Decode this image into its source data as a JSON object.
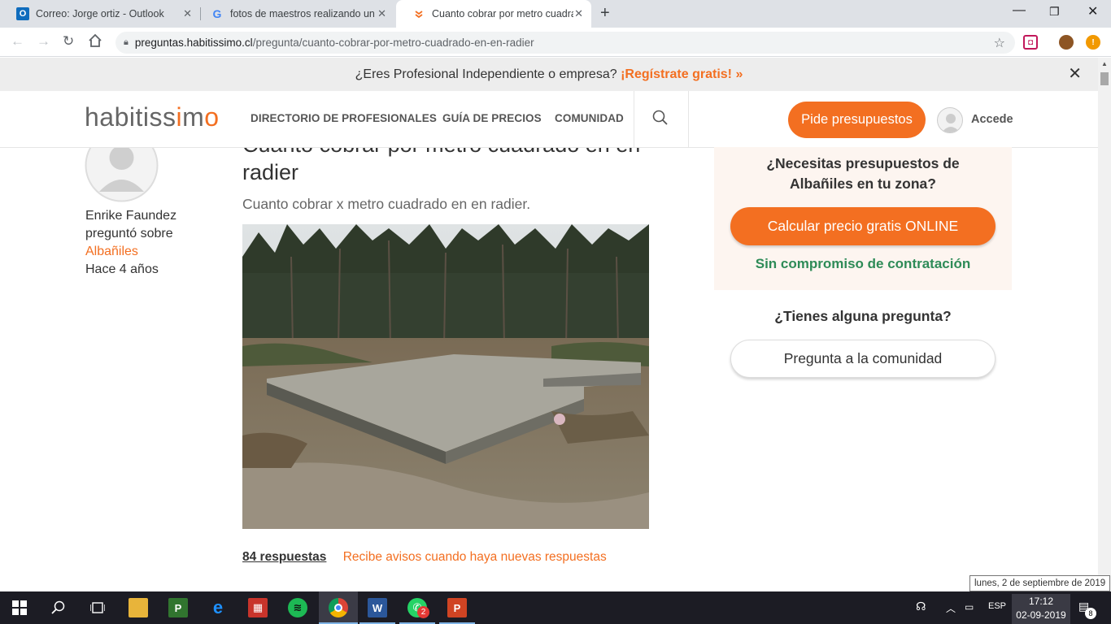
{
  "browser": {
    "tabs": [
      {
        "title": "Correo: Jorge ortiz - Outlook",
        "favicon": "outlook-icon"
      },
      {
        "title": "fotos de maestros realizando un",
        "favicon": "google-icon"
      },
      {
        "title": "Cuanto cobrar por metro cuadrado",
        "favicon": "habitissimo-icon"
      }
    ],
    "url_host": "preguntas.habitissimo.cl",
    "url_path": "/pregunta/cuanto-cobrar-por-metro-cuadrado-en-en-radier"
  },
  "promo": {
    "text": "¿Eres Profesional Independiente o empresa?",
    "cta": "¡Regístrate gratis! »"
  },
  "header": {
    "logo_a": "habitiss",
    "logo_b": "i",
    "logo_c": "m",
    "logo_d": "o",
    "nav": [
      "DIRECTORIO DE PROFESIONALES",
      "GUÍA DE PRECIOS",
      "COMUNIDAD"
    ],
    "cta_button": "Pide presupuestos",
    "login": "Accede"
  },
  "question": {
    "title_line1": "Cuanto cobrar por metro cuadrado en en",
    "title_line2": "radier",
    "description": "Cuanto cobrar x metro cuadrado en en radier.",
    "answers_count": "84 respuestas",
    "notify_link": "Recibe avisos cuando haya nuevas respuestas"
  },
  "author": {
    "name": "Enrike Faundez",
    "verb": "preguntó sobre",
    "category": "Albañiles",
    "time": "Hace 4 años"
  },
  "sidebar": {
    "promo_heading_1": "¿Necesitas presupuestos de",
    "promo_heading_2": "Albañiles en tu zona?",
    "calc_button": "Calcular precio gratis ONLINE",
    "no_commitment": "Sin compromiso de contratación",
    "question_heading": "¿Tienes alguna pregunta?",
    "community_button": "Pregunta a la comunidad"
  },
  "taskbar": {
    "language": "ESP",
    "time": "17:12",
    "date": "02-09-2019",
    "tooltip": "lunes, 2 de septiembre de 2019",
    "whatsapp_badge": "2",
    "notifications": "8"
  },
  "colors": {
    "brand_orange": "#f36f21",
    "green": "#2e8b57",
    "sidebar_bg": "#fdf5f0"
  }
}
